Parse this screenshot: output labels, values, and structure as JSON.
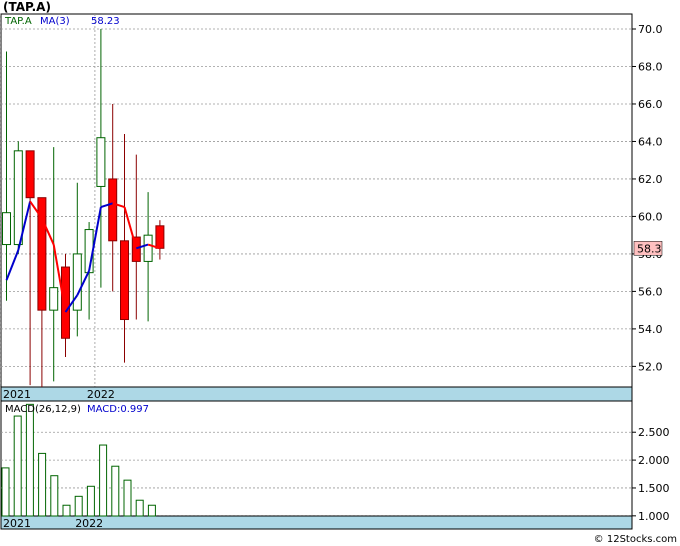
{
  "title": "(TAP.A)",
  "footer": "© 12Stocks.com",
  "colors": {
    "up_fill": "#ffffff",
    "up_stroke": "#006400",
    "down_fill": "#ff0000",
    "down_stroke": "#8b0000",
    "wick": "#006400",
    "ma_up": "#0000cc",
    "ma_down": "#ff0000",
    "macd_bar": "#006400",
    "date_band": "#add8e6",
    "grid": "#999999",
    "last_price_bg": "#ffc0c0"
  },
  "chart_data": [
    {
      "type": "candlestick",
      "legend": [
        {
          "label": "TAP.A",
          "color": "#006400"
        },
        {
          "label": "MA(3)",
          "color": "#0000cc"
        },
        {
          "label": "58.23",
          "color": "#0000cc"
        }
      ],
      "ylim": [
        50.9,
        70.8
      ],
      "y_ticks": [
        "52.0",
        "54.0",
        "56.0",
        "58.0",
        "60.0",
        "62.0",
        "64.0",
        "66.0",
        "68.0",
        "70.0"
      ],
      "x_labels": [
        {
          "label": "2021",
          "index": 0
        },
        {
          "label": "2022",
          "index": 8
        }
      ],
      "last_price": "58.3",
      "candles": [
        {
          "open": 58.5,
          "high": 68.8,
          "low": 55.5,
          "close": 60.2
        },
        {
          "open": 58.5,
          "high": 64.0,
          "low": 58.0,
          "close": 63.5
        },
        {
          "open": 63.5,
          "high": 63.5,
          "low": 51.0,
          "close": 61.0
        },
        {
          "open": 61.0,
          "high": 61.0,
          "low": 50.9,
          "close": 55.0
        },
        {
          "open": 55.0,
          "high": 63.7,
          "low": 51.2,
          "close": 56.2
        },
        {
          "open": 57.3,
          "high": 58.0,
          "low": 52.5,
          "close": 53.5
        },
        {
          "open": 55.0,
          "high": 61.8,
          "low": 53.6,
          "close": 58.0
        },
        {
          "open": 57.0,
          "high": 59.7,
          "low": 54.5,
          "close": 59.3
        },
        {
          "open": 61.6,
          "high": 70.0,
          "low": 56.2,
          "close": 64.2
        },
        {
          "open": 62.0,
          "high": 66.0,
          "low": 56.0,
          "close": 58.7
        },
        {
          "open": 58.7,
          "high": 64.4,
          "low": 52.2,
          "close": 54.5
        },
        {
          "open": 58.9,
          "high": 63.3,
          "low": 54.5,
          "close": 57.6
        },
        {
          "open": 57.6,
          "high": 61.3,
          "low": 54.4,
          "close": 59.0
        },
        {
          "open": 59.5,
          "high": 59.8,
          "low": 57.7,
          "close": 58.3
        }
      ],
      "ma": [
        56.6,
        58.2,
        60.8,
        59.9,
        58.5,
        54.9,
        55.8,
        57.1,
        60.5,
        60.7,
        60.5,
        58.3,
        58.5,
        58.3
      ]
    },
    {
      "type": "bar",
      "legend": [
        {
          "label": "MACD(26,12,9)",
          "color": "#000000"
        },
        {
          "label": "MACD:0.997",
          "color": "#0000cc"
        }
      ],
      "ylim": [
        0.997,
        3.06
      ],
      "y_ticks": [
        "1.000",
        "1.500",
        "2.000",
        "2.500"
      ],
      "x_labels": [
        {
          "label": "2021",
          "index": 0
        },
        {
          "label": "2022",
          "index": 6
        }
      ],
      "values": [
        1.86,
        2.79,
        3.0,
        2.12,
        1.72,
        1.19,
        1.35,
        1.53,
        2.27,
        1.89,
        1.64,
        1.28,
        1.19
      ]
    }
  ]
}
